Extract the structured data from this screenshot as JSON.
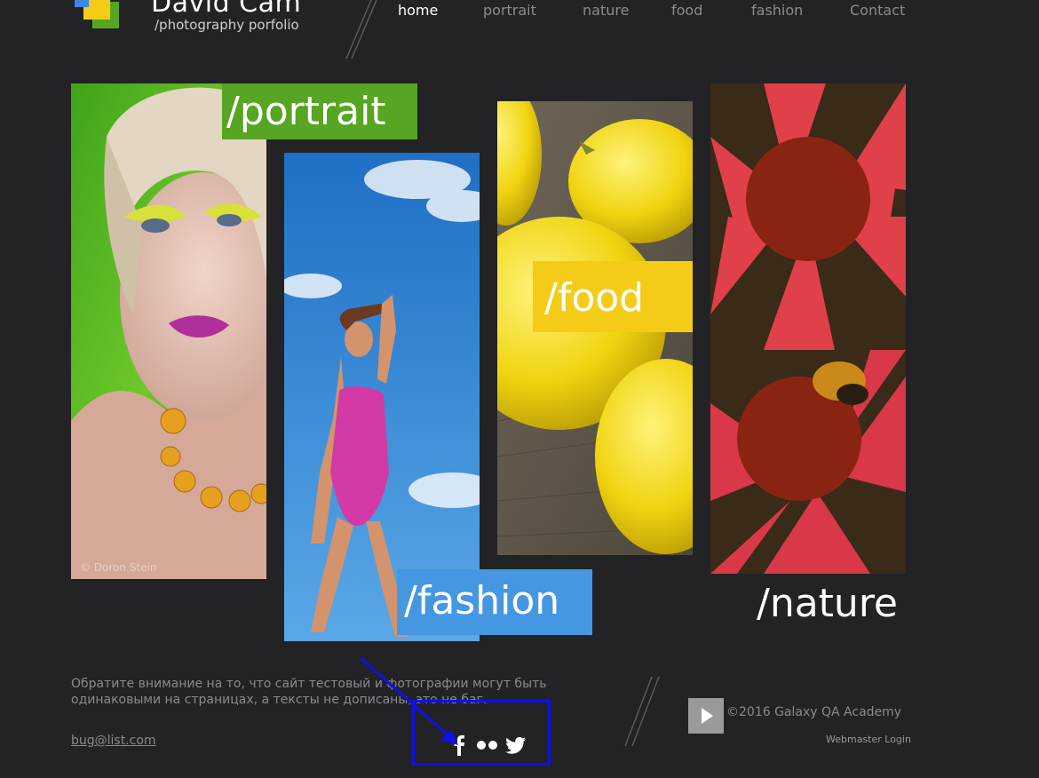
{
  "header": {
    "title": "David Cam",
    "subtitle": "/photography porfolio",
    "nav": [
      {
        "label": "home",
        "active": true
      },
      {
        "label": "portrait",
        "active": false
      },
      {
        "label": "nature",
        "active": false
      },
      {
        "label": "food",
        "active": false
      },
      {
        "label": "fashion",
        "active": false
      },
      {
        "label": "Contact",
        "active": false
      }
    ]
  },
  "gallery": {
    "portrait": {
      "label": "/portrait",
      "watermark": "© Doron Stein",
      "label_color": "#57a522"
    },
    "fashion": {
      "label": "/fashion",
      "label_color": "#4697e2"
    },
    "food": {
      "label": "/food",
      "label_color": "#f4cc17"
    },
    "nature": {
      "label": "/nature"
    }
  },
  "footer": {
    "notice": "Обратите внимание на то, что сайт тестовый и фотографии могут быть одинаковыми на страницах, а тексты не дописаны, это не баг.",
    "email": "bug@list.com",
    "social": [
      {
        "icon": "facebook-icon"
      },
      {
        "icon": "flickr-icon"
      },
      {
        "icon": "twitter-icon"
      }
    ],
    "copyright": "©2016 Galaxy QA Academy",
    "webmaster": "Webmaster Login"
  },
  "colors": {
    "background": "#232325",
    "annotation": "#1010e8"
  }
}
